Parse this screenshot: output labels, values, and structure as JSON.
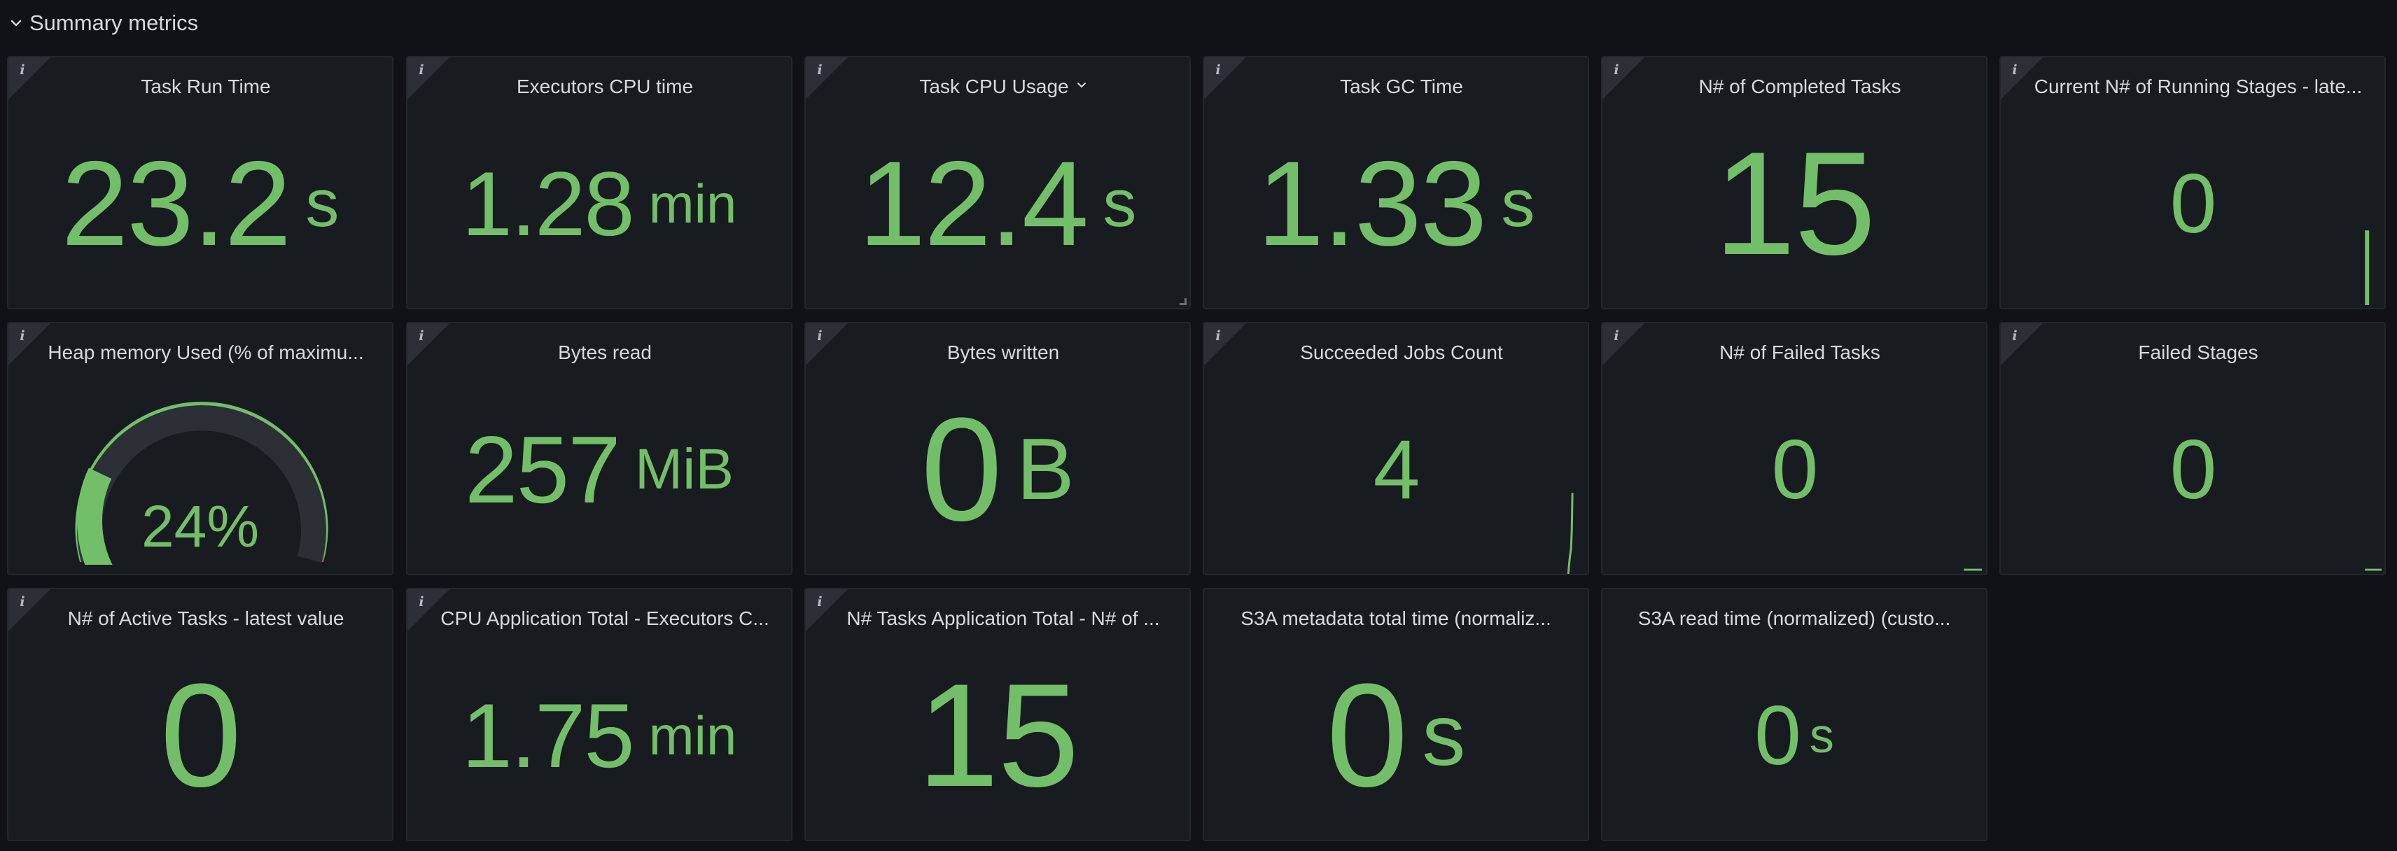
{
  "row": {
    "title": "Summary metrics"
  },
  "colors": {
    "value_green": "#73bf69",
    "gauge_track": "#2c2f35",
    "gauge_red": "#f2495c",
    "panel_bg": "#181b1f",
    "page_bg": "#111217"
  },
  "panels": [
    {
      "title": "Task Run Time",
      "value": "23.2",
      "unit": "s"
    },
    {
      "title": "Executors CPU time",
      "value": "1.28",
      "unit": "min"
    },
    {
      "title": "Task CPU Usage",
      "value": "12.4",
      "unit": "s"
    },
    {
      "title": "Task GC Time",
      "value": "1.33",
      "unit": "s"
    },
    {
      "title": "N# of Completed Tasks",
      "value": "15",
      "unit": ""
    },
    {
      "title": "Current N# of Running Stages - late...",
      "value": "0",
      "unit": ""
    },
    {
      "title": "Heap memory Used (% of maximu...",
      "value": "24%",
      "unit": "",
      "gauge_percent": 24
    },
    {
      "title": "Bytes read",
      "value": "257",
      "unit": "MiB"
    },
    {
      "title": "Bytes written",
      "value": "0",
      "unit": "B"
    },
    {
      "title": "Succeeded Jobs Count",
      "value": "4",
      "unit": ""
    },
    {
      "title": "N# of Failed Tasks",
      "value": "0",
      "unit": ""
    },
    {
      "title": "Failed Stages",
      "value": "0",
      "unit": ""
    },
    {
      "title": "N# of Active Tasks - latest value",
      "value": "0",
      "unit": ""
    },
    {
      "title": "CPU Application Total - Executors C...",
      "value": "1.75",
      "unit": "min"
    },
    {
      "title": "N# Tasks Application Total - N# of ...",
      "value": "15",
      "unit": ""
    },
    {
      "title": "S3A metadata total time (normaliz...",
      "value": "0",
      "unit": "s"
    },
    {
      "title": "S3A read time (normalized) (custo...",
      "value": "0",
      "unit": "s"
    }
  ]
}
